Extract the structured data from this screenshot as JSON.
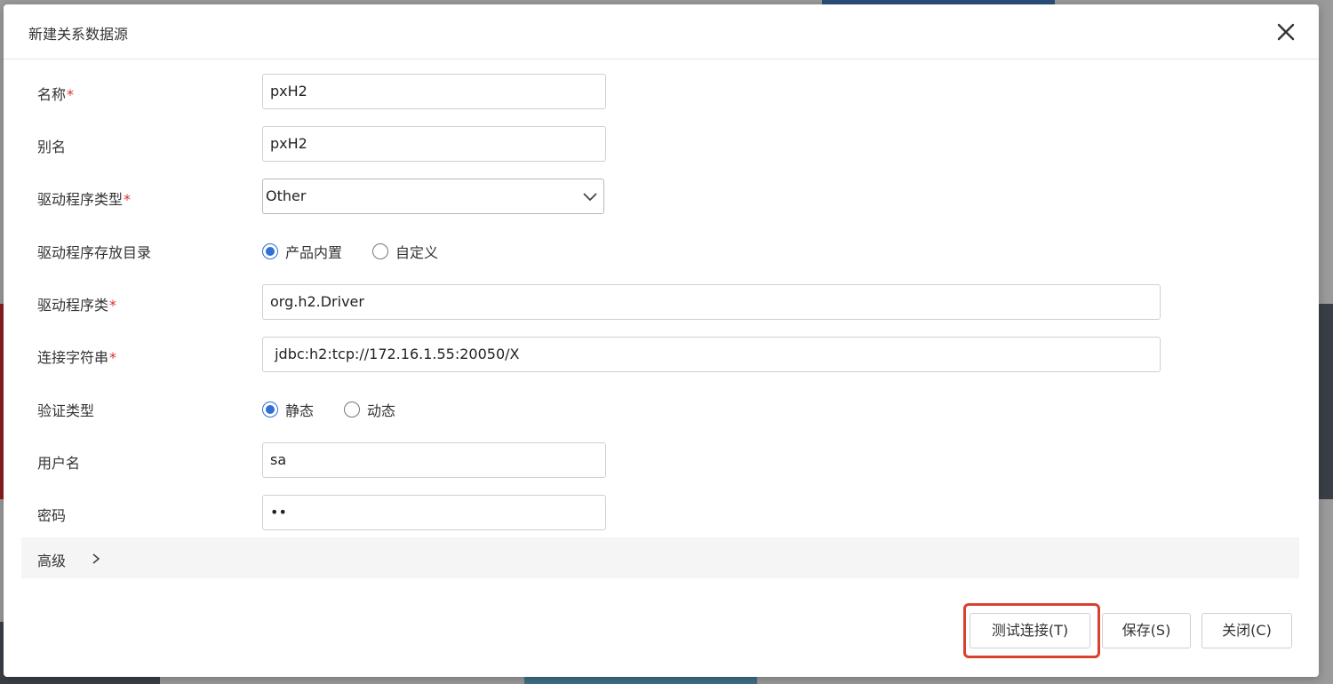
{
  "dialog": {
    "title": "新建关系数据源"
  },
  "form": {
    "name": {
      "label": "名称",
      "required_mark": "*",
      "value": "pxH2"
    },
    "alias": {
      "label": "别名",
      "value": "pxH2"
    },
    "driver_type": {
      "label": "驱动程序类型",
      "required_mark": "*",
      "value": "Other"
    },
    "driver_dir": {
      "label": "驱动程序存放目录",
      "options": [
        "产品内置",
        "自定义"
      ],
      "selected": "产品内置"
    },
    "driver_class": {
      "label": "驱动程序类",
      "required_mark": "*",
      "value": "org.h2.Driver"
    },
    "conn_string": {
      "label": "连接字符串",
      "required_mark": "*",
      "value": " jdbc:h2:tcp://172.16.1.55:20050/X"
    },
    "auth_type": {
      "label": "验证类型",
      "options": [
        "静态",
        "动态"
      ],
      "selected": "静态"
    },
    "username": {
      "label": "用户名",
      "value": "sa"
    },
    "password": {
      "label": "密码",
      "value": "••"
    }
  },
  "advanced": {
    "label": "高级"
  },
  "buttons": {
    "test": "测试连接(T)",
    "save": "保存(S)",
    "close": "关闭(C)"
  },
  "colors": {
    "accent": "#2f6fd6",
    "required": "#d9302b",
    "highlight": "#d9412f"
  }
}
